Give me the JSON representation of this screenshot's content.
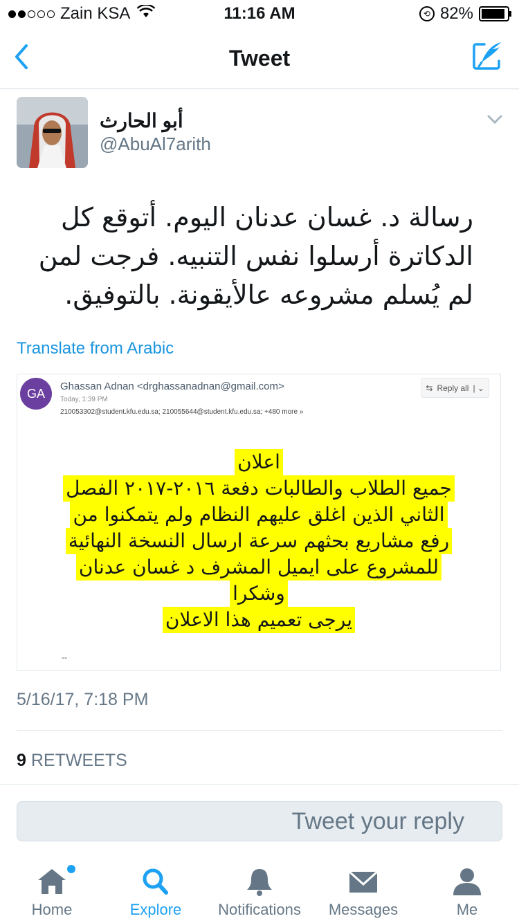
{
  "status_bar": {
    "carrier": "Zain KSA",
    "time": "11:16 AM",
    "battery": "82%",
    "signal_bars_filled": 2,
    "signal_bars_total": 5
  },
  "nav": {
    "title": "Tweet",
    "back_icon": "chevron-left-icon",
    "compose_icon": "compose-tweet-icon"
  },
  "author": {
    "display_name": "أبو الحارث",
    "handle": "@AbuAl7arith"
  },
  "tweet": {
    "text": "رسالة د. غسان عدنان اليوم. أتوقع كل الدكاترة أرسلوا نفس التنبيه. فرجت لمن لم يُسلم مشروعه عالأيقونة. بالتوفيق.",
    "translate_label": "Translate from Arabic"
  },
  "email": {
    "avatar_initials": "GA",
    "sender": "Ghassan Adnan <drghassanadnan@gmail.com>",
    "date": "Today, 1:39 PM",
    "recipients": "210053302@student.kfu.edu.sa;  210055644@student.kfu.edu.sa;  +480 more",
    "reply_all_label": "Reply all",
    "body_lines": [
      "اعلان",
      "جميع الطلاب والطالبات دفعة ٢٠١٦-٢٠١٧ الفصل",
      "الثاني الذين اغلق عليهم النظام ولم يتمكنوا من",
      "رفع مشاريع بحثهم سرعة ارسال النسخة النهائية",
      "للمشروع على ايميل المشرف د غسان عدنان",
      "وشكرا",
      "يرجى تعميم هذا الاعلان"
    ],
    "signature": "--",
    "highlight_color": "#ffff00"
  },
  "timestamp": "5/16/17, 7:18 PM",
  "stats": {
    "retweets_count": "9",
    "retweets_label": "RETWEETS"
  },
  "reply_box": {
    "placeholder": "Tweet your reply"
  },
  "tabs": [
    {
      "label": "Home",
      "icon": "home-icon"
    },
    {
      "label": "Explore",
      "icon": "search-icon",
      "active": true
    },
    {
      "label": "Notifications",
      "icon": "bell-icon"
    },
    {
      "label": "Messages",
      "icon": "envelope-icon"
    },
    {
      "label": "Me",
      "icon": "person-icon"
    }
  ],
  "colors": {
    "accent": "#1da1f2",
    "link": "#1b95e0",
    "secondary_text": "#657786"
  }
}
